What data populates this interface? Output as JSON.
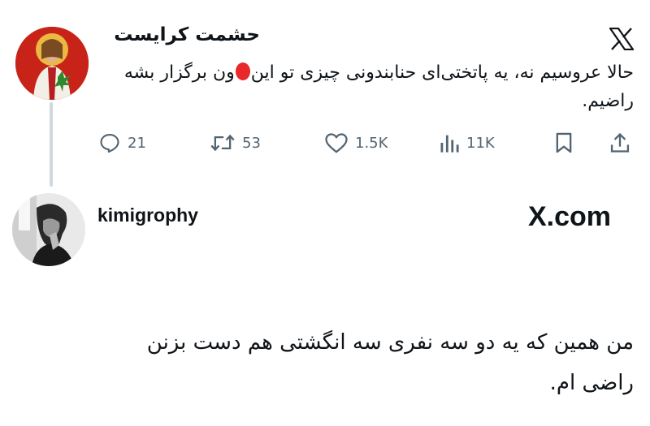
{
  "top_tweet": {
    "author_name": "حشمت کرایست",
    "text_before_emoji": "حالا عروسیم نه، یه پاتختی‌ای حنابندونی چیزی تو این",
    "text_after_emoji": "ون برگزار بشه راضیم.",
    "actions": {
      "replies": "21",
      "reposts": "53",
      "likes": "1.5K",
      "views": "11K"
    }
  },
  "reply_tweet": {
    "author_name": "kimigrophy",
    "watermark": "X.com",
    "text_line1": "من همین که یه دو سه نفری سه انگشتی هم دست بزنن",
    "text_line2": "راضی ام."
  },
  "icons": {
    "brand": "x-logo-icon",
    "reply": "speech-bubble-icon",
    "repost": "repost-arrows-icon",
    "like": "heart-icon",
    "views": "bar-chart-icon",
    "bookmark": "bookmark-icon",
    "share": "share-upload-icon"
  },
  "colors": {
    "text": "#0f1419",
    "muted": "#536471",
    "thread_line": "#cfd9de",
    "avatar_red": "#c82318",
    "emoji_red": "#e8282b"
  }
}
